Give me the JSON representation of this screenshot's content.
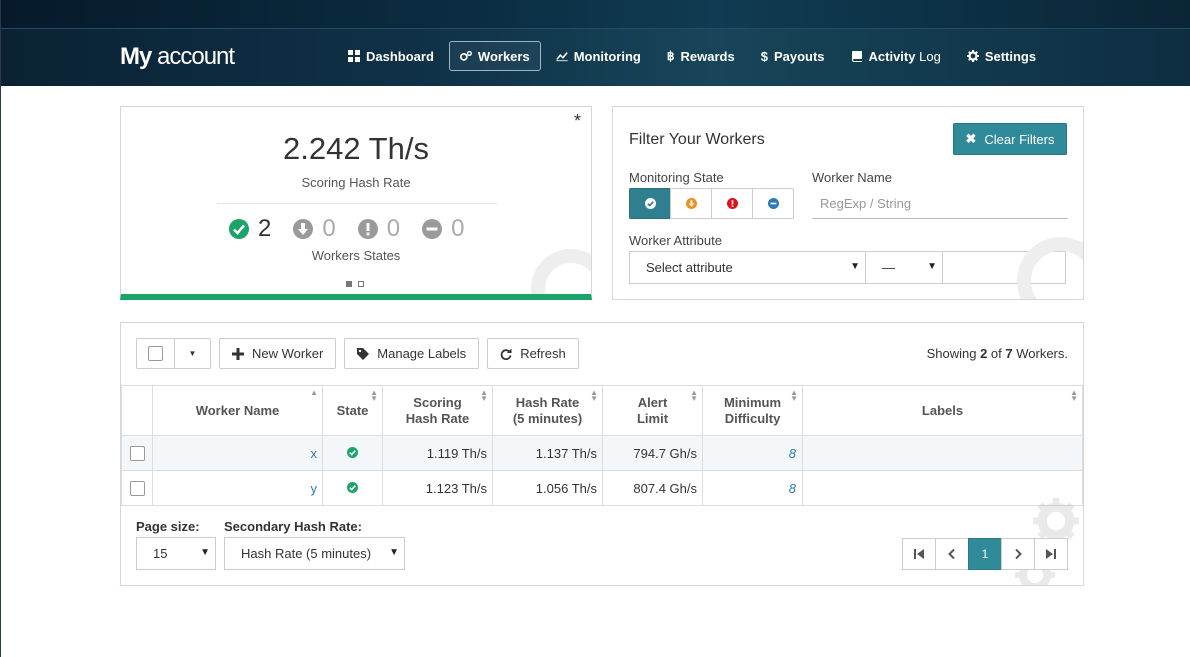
{
  "header": {
    "brand_bold": "My",
    "brand_rest": " account",
    "nav": [
      {
        "icon": "dashboard-icon",
        "label": "Dashboard",
        "light": ""
      },
      {
        "icon": "workers-icon",
        "label": "Workers",
        "light": ""
      },
      {
        "icon": "monitoring-icon",
        "label": "Monitoring",
        "light": ""
      },
      {
        "icon": "bitcoin-icon",
        "label": "Rewards",
        "light": ""
      },
      {
        "icon": "dollar-icon",
        "label": "Payouts",
        "light": ""
      },
      {
        "icon": "book-icon",
        "label": "Activity",
        "light": "Log"
      },
      {
        "icon": "gear-icon",
        "label": "Settings",
        "light": ""
      }
    ],
    "active_nav": "Workers"
  },
  "stats": {
    "asterisk": "*",
    "hash_rate": "2.242 Th/s",
    "hash_rate_label": "Scoring Hash Rate",
    "states": {
      "ok": "2",
      "low": "0",
      "dead": "0",
      "off": "0"
    },
    "states_label": "Workers States",
    "accent_color": "#1aa469"
  },
  "filter": {
    "title": "Filter Your Workers",
    "clear_label": "Clear Filters",
    "monitoring_label": "Monitoring State",
    "worker_name_label": "Worker Name",
    "worker_name_placeholder": "RegExp / String",
    "worker_name_value": "",
    "attribute_label": "Worker Attribute",
    "attribute_select": "Select attribute",
    "operator_select": "—",
    "attribute_value": ""
  },
  "table": {
    "new_worker": "New Worker",
    "manage_labels": "Manage Labels",
    "refresh": "Refresh",
    "showing_pre": "Showing ",
    "showing_count": "2",
    "showing_mid": " of ",
    "showing_total": "7",
    "showing_post": " Workers.",
    "columns": [
      "Worker Name",
      "State",
      "Scoring Hash Rate",
      "Hash Rate (5 minutes)",
      "Alert Limit",
      "Minimum Difficulty",
      "Labels"
    ],
    "col_lines": {
      "c3a": "Scoring",
      "c3b": "Hash Rate",
      "c4a": "Hash Rate",
      "c4b": "(5 minutes)",
      "c5a": "Alert",
      "c5b": "Limit",
      "c6a": "Minimum",
      "c6b": "Difficulty"
    },
    "rows": [
      {
        "name": "x",
        "state": "ok",
        "scoring": "1.119 Th/s",
        "hash5": "1.137 Th/s",
        "alert": "794.7 Gh/s",
        "difficulty": "8",
        "labels": ""
      },
      {
        "name": "y",
        "state": "ok",
        "scoring": "1.123 Th/s",
        "hash5": "1.056 Th/s",
        "alert": "807.4 Gh/s",
        "difficulty": "8",
        "labels": ""
      }
    ],
    "page_size_label": "Page size:",
    "page_size": "15",
    "secondary_label": "Secondary Hash Rate:",
    "secondary_value": "Hash Rate (5 minutes)",
    "current_page": "1"
  }
}
